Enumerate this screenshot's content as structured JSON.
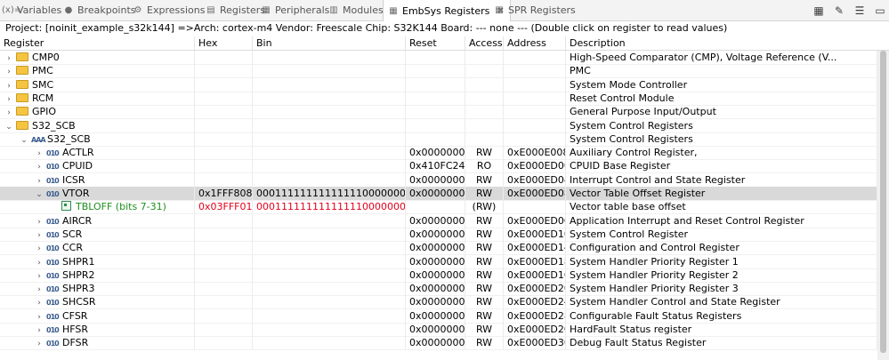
{
  "tabs": [
    {
      "label": "Variables",
      "icon": "(x)="
    },
    {
      "label": "Breakpoints",
      "icon": "●"
    },
    {
      "label": "Expressions",
      "icon": "⚙"
    },
    {
      "label": "Registers",
      "icon": "▤"
    },
    {
      "label": "Peripherals",
      "icon": "▦"
    },
    {
      "label": "Modules",
      "icon": "▥"
    },
    {
      "label": "EmbSys Registers",
      "icon": "▦",
      "active": true
    },
    {
      "label": "SPR Registers",
      "icon": "▦"
    }
  ],
  "toolbar_icons": [
    "table-icon",
    "pin-icon",
    "menu-doc-icon",
    "minimize-icon"
  ],
  "project_line": "Project: [noinit_example_s32k144] =>Arch: cortex-m4  Vendor: Freescale  Chip: S32K144  Board: ---  none ---        (Double click on register to read values)",
  "columns": [
    "Register",
    "Hex",
    "Bin",
    "Reset",
    "Access",
    "Address",
    "Description"
  ],
  "rows": [
    {
      "type": "folder",
      "indent": 0,
      "expander": "closed",
      "name": "CMP0",
      "hex": "",
      "bin": "",
      "reset": "",
      "access": "",
      "address": "",
      "desc": "High-Speed Comparator (CMP), Voltage Reference (V..."
    },
    {
      "type": "folder",
      "indent": 0,
      "expander": "closed",
      "name": "PMC",
      "hex": "",
      "bin": "",
      "reset": "",
      "access": "",
      "address": "",
      "desc": "PMC"
    },
    {
      "type": "folder",
      "indent": 0,
      "expander": "closed",
      "name": "SMC",
      "hex": "",
      "bin": "",
      "reset": "",
      "access": "",
      "address": "",
      "desc": "System Mode Controller"
    },
    {
      "type": "folder",
      "indent": 0,
      "expander": "closed",
      "name": "RCM",
      "hex": "",
      "bin": "",
      "reset": "",
      "access": "",
      "address": "",
      "desc": "Reset Control Module"
    },
    {
      "type": "folder",
      "indent": 0,
      "expander": "closed",
      "name": "GPIO",
      "hex": "",
      "bin": "",
      "reset": "",
      "access": "",
      "address": "",
      "desc": "General Purpose Input/Output"
    },
    {
      "type": "folder",
      "indent": 0,
      "expander": "open",
      "name": "S32_SCB",
      "hex": "",
      "bin": "",
      "reset": "",
      "access": "",
      "address": "",
      "desc": "System Control Registers"
    },
    {
      "type": "group",
      "indent": 1,
      "expander": "open",
      "name": "S32_SCB",
      "hex": "",
      "bin": "",
      "reset": "",
      "access": "",
      "address": "",
      "desc": "System Control Registers"
    },
    {
      "type": "reg",
      "indent": 2,
      "expander": "closed",
      "name": "ACTLR",
      "hex": "",
      "bin": "",
      "reset": "0x00000000",
      "access": "RW",
      "address": "0xE000E008",
      "desc": "Auxiliary Control Register,"
    },
    {
      "type": "reg",
      "indent": 2,
      "expander": "closed",
      "name": "CPUID",
      "hex": "",
      "bin": "",
      "reset": "0x410FC240",
      "access": "RO",
      "address": "0xE000ED00",
      "desc": "CPUID Base Register"
    },
    {
      "type": "reg",
      "indent": 2,
      "expander": "closed",
      "name": "ICSR",
      "hex": "",
      "bin": "",
      "reset": "0x00000000",
      "access": "RW",
      "address": "0xE000ED04",
      "desc": "Interrupt Control and State Register"
    },
    {
      "type": "reg",
      "indent": 2,
      "expander": "open",
      "selected": true,
      "name": "VTOR",
      "hex": "0x1FFF8080",
      "bin": "00011111111111111000000010000000",
      "reset": "0x00000000",
      "access": "RW",
      "address": "0xE000ED08",
      "desc": "Vector Table Offset Register"
    },
    {
      "type": "field",
      "indent": 3,
      "expander": "",
      "name": "TBLOFF (bits 7-31)",
      "hex": "0x03FFF01",
      "bin": "0001111111111111100000001",
      "reset": "",
      "access": "(RW)",
      "address": "",
      "desc": "Vector table base offset"
    },
    {
      "type": "reg",
      "indent": 2,
      "expander": "closed",
      "name": "AIRCR",
      "hex": "",
      "bin": "",
      "reset": "0x00000000",
      "access": "RW",
      "address": "0xE000ED0C",
      "desc": "Application Interrupt and Reset Control Register"
    },
    {
      "type": "reg",
      "indent": 2,
      "expander": "closed",
      "name": "SCR",
      "hex": "",
      "bin": "",
      "reset": "0x00000000",
      "access": "RW",
      "address": "0xE000ED10",
      "desc": "System Control Register"
    },
    {
      "type": "reg",
      "indent": 2,
      "expander": "closed",
      "name": "CCR",
      "hex": "",
      "bin": "",
      "reset": "0x00000000",
      "access": "RW",
      "address": "0xE000ED14",
      "desc": "Configuration and Control Register"
    },
    {
      "type": "reg",
      "indent": 2,
      "expander": "closed",
      "name": "SHPR1",
      "hex": "",
      "bin": "",
      "reset": "0x00000000",
      "access": "RW",
      "address": "0xE000ED18",
      "desc": "System Handler Priority Register 1"
    },
    {
      "type": "reg",
      "indent": 2,
      "expander": "closed",
      "name": "SHPR2",
      "hex": "",
      "bin": "",
      "reset": "0x00000000",
      "access": "RW",
      "address": "0xE000ED1C",
      "desc": "System Handler Priority Register 2"
    },
    {
      "type": "reg",
      "indent": 2,
      "expander": "closed",
      "name": "SHPR3",
      "hex": "",
      "bin": "",
      "reset": "0x00000000",
      "access": "RW",
      "address": "0xE000ED20",
      "desc": "System Handler Priority Register 3"
    },
    {
      "type": "reg",
      "indent": 2,
      "expander": "closed",
      "name": "SHCSR",
      "hex": "",
      "bin": "",
      "reset": "0x00000000",
      "access": "RW",
      "address": "0xE000ED24",
      "desc": "System Handler Control and State Register"
    },
    {
      "type": "reg",
      "indent": 2,
      "expander": "closed",
      "name": "CFSR",
      "hex": "",
      "bin": "",
      "reset": "0x00000000",
      "access": "RW",
      "address": "0xE000ED28",
      "desc": "Configurable Fault Status Registers"
    },
    {
      "type": "reg",
      "indent": 2,
      "expander": "closed",
      "name": "HFSR",
      "hex": "",
      "bin": "",
      "reset": "0x00000000",
      "access": "RW",
      "address": "0xE000ED2C",
      "desc": "HardFault Status register"
    },
    {
      "type": "reg",
      "indent": 2,
      "expander": "closed",
      "name": "DFSR",
      "hex": "",
      "bin": "",
      "reset": "0x00000000",
      "access": "RW",
      "address": "0xE000ED30",
      "desc": "Debug Fault Status Register"
    }
  ],
  "colors": {
    "selected_row": "#d9d9d9",
    "field_value": "#e3001b",
    "field_name": "#1f8f1f"
  }
}
